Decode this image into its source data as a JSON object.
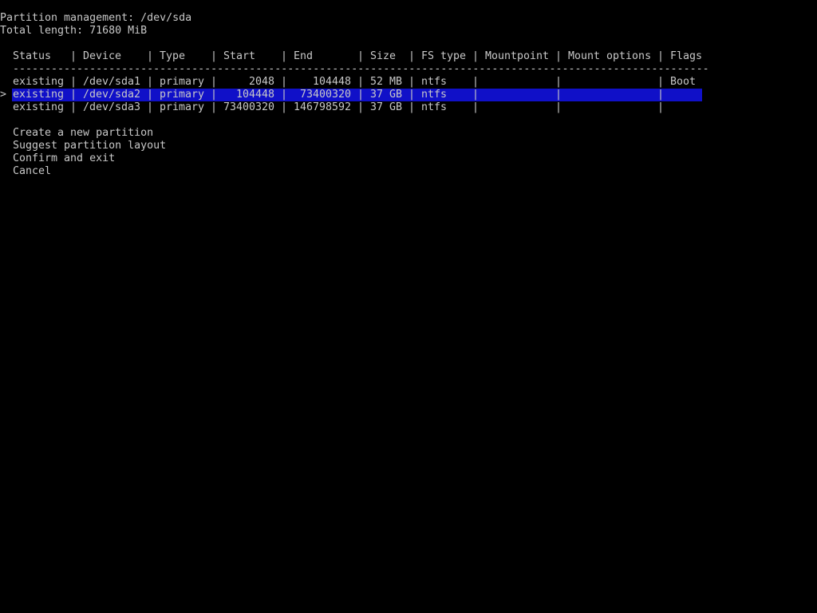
{
  "title": "Partition management: /dev/sda",
  "total_length": "Total length: 71680 MiB",
  "separator": "-------------------------------------------------------------------------------------------------------------",
  "columns": {
    "status": "Status",
    "device": "Device",
    "type": "Type",
    "start": "Start",
    "end": "End",
    "size": "Size",
    "fstype": "FS type",
    "mountpoint": "Mountpoint",
    "mount_options": "Mount options",
    "flags": "Flags"
  },
  "col_sep": "|",
  "cursor_glyph": ">",
  "highlight_color": "#1010c8",
  "text_color": "#c8c8c8",
  "partitions": [
    {
      "status": "existing",
      "device": "/dev/sda1",
      "type": "primary",
      "start": "2048",
      "end": "104448",
      "size": "52 MB",
      "fstype": "ntfs",
      "mountpoint": "",
      "mount_options": "",
      "flags": "Boot",
      "selected": false
    },
    {
      "status": "existing",
      "device": "/dev/sda2",
      "type": "primary",
      "start": "104448",
      "end": "73400320",
      "size": "37 GB",
      "fstype": "ntfs",
      "mountpoint": "",
      "mount_options": "",
      "flags": "",
      "selected": true
    },
    {
      "status": "existing",
      "device": "/dev/sda3",
      "type": "primary",
      "start": "73400320",
      "end": "146798592",
      "size": "37 GB",
      "fstype": "ntfs",
      "mountpoint": "",
      "mount_options": "",
      "flags": "",
      "selected": false
    }
  ],
  "menu": [
    {
      "label": "Create a new partition"
    },
    {
      "label": "Suggest partition layout"
    },
    {
      "label": "Confirm and exit"
    },
    {
      "label": "Cancel"
    }
  ]
}
